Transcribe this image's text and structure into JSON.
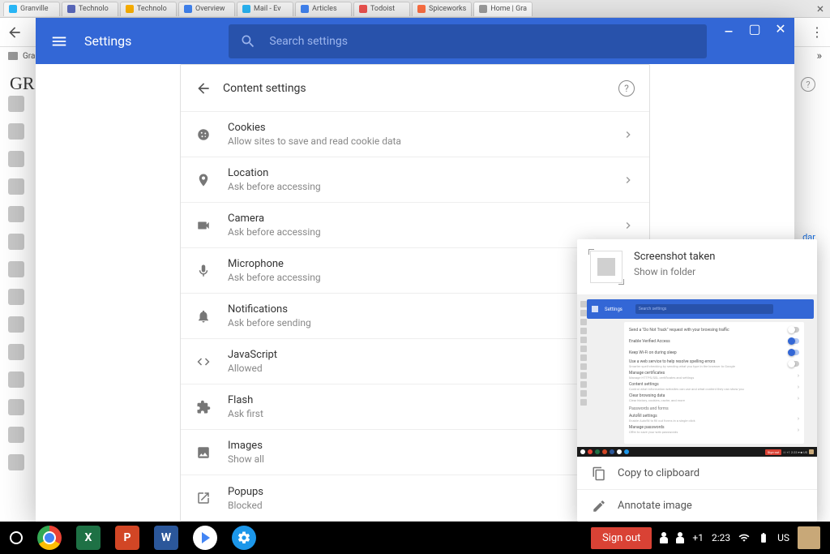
{
  "bg_tabs": [
    {
      "label": "Granville",
      "favicon": "#29b6f6"
    },
    {
      "label": "Technolo",
      "favicon": "#5c6bc0"
    },
    {
      "label": "Technolo",
      "favicon": "#ffb300"
    },
    {
      "label": "Overview",
      "favicon": "#4285f4"
    },
    {
      "label": "Mail - Ev",
      "favicon": "#29b6f6"
    },
    {
      "label": "Articles",
      "favicon": "#4285f4"
    },
    {
      "label": "Todoist",
      "favicon": "#ef5350"
    },
    {
      "label": "Spiceworks",
      "favicon": "#ff7043"
    },
    {
      "label": "Home | Gra",
      "favicon": "#9e9e9e",
      "active": true
    }
  ],
  "bg_bookmark": "Gra",
  "bg_logo_text": "GR",
  "bg_right_link": "dar",
  "settings": {
    "title": "Settings",
    "search_placeholder": "Search settings",
    "content_title": "Content settings",
    "rows": [
      {
        "title": "Cookies",
        "sub": "Allow sites to save and read cookie data",
        "icon": "cookie"
      },
      {
        "title": "Location",
        "sub": "Ask before accessing",
        "icon": "location"
      },
      {
        "title": "Camera",
        "sub": "Ask before accessing",
        "icon": "camera"
      },
      {
        "title": "Microphone",
        "sub": "Ask before accessing",
        "icon": "microphone"
      },
      {
        "title": "Notifications",
        "sub": "Ask before sending",
        "icon": "bell"
      },
      {
        "title": "JavaScript",
        "sub": "Allowed",
        "icon": "code"
      },
      {
        "title": "Flash",
        "sub": "Ask first",
        "icon": "puzzle"
      },
      {
        "title": "Images",
        "sub": "Show all",
        "icon": "image"
      },
      {
        "title": "Popups",
        "sub": "Blocked",
        "icon": "popup"
      }
    ]
  },
  "notif": {
    "title": "Screenshot taken",
    "sub": "Show in folder",
    "action_copy": "Copy to clipboard",
    "action_annotate": "Annotate image",
    "preview": {
      "title": "Settings",
      "search": "Search settings",
      "rows": [
        {
          "text": "Send a \"Do Not Track\" request with your browsing traffic",
          "toggle": false
        },
        {
          "text": "Enable Verified Access",
          "toggle": true
        },
        {
          "text": "Keep Wi-Fi on during sleep",
          "toggle": true
        },
        {
          "text": "Use a web service to help resolve spelling errors",
          "sub": "Smarter spell-checking by sending what you type in the browser to Google",
          "toggle": false
        },
        {
          "text": "Manage certificates",
          "sub": "Manage HTTPS/SSL certificates and settings",
          "chev": true
        },
        {
          "text": "Content settings",
          "sub": "Control what information websites can use and what content they can show you",
          "chev": true
        },
        {
          "text": "Clear browsing data",
          "sub": "Clear history, cookies, cache, and more",
          "chev": true
        }
      ],
      "section": "Passwords and forms",
      "rows2": [
        {
          "text": "Autofill settings",
          "sub": "Enable Autofill to fill out forms in a single click",
          "chev": true
        },
        {
          "text": "Manage passwords",
          "sub": "Offer to save your web passwords",
          "chev": true
        }
      ]
    }
  },
  "shelf": {
    "signout": "Sign out",
    "plus_count": "+1",
    "time": "2:23",
    "region": "US"
  }
}
